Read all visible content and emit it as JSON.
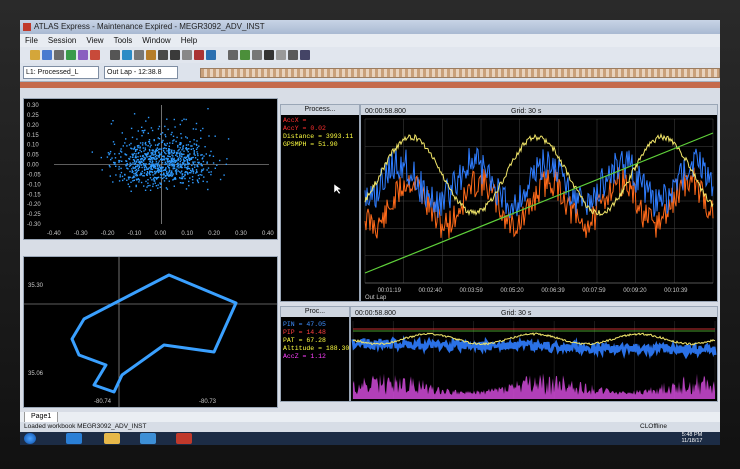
{
  "window": {
    "title": "ATLAS Express - Maintenance Expired - MEGR3092_ADV_INST"
  },
  "menu": [
    "File",
    "Session",
    "View",
    "Tools",
    "Window",
    "Help"
  ],
  "toolbar": {
    "session_combo": "L1: Processed_L",
    "lap_combo": "Out Lap - 12:38.8"
  },
  "scatter_panel": {
    "y_ticks": [
      "0.30",
      "0.25",
      "0.20",
      "0.15",
      "0.10",
      "0.05",
      "0.00",
      "-0.05",
      "-0.10",
      "-0.15",
      "-0.20",
      "-0.25",
      "-0.30"
    ],
    "x_ticks": [
      "-0.40",
      "-0.30",
      "-0.20",
      "-0.10",
      "0.00",
      "0.10",
      "0.20",
      "0.30",
      "0.40"
    ]
  },
  "track_panel": {
    "y_ticks": [
      "35.06",
      "35.30"
    ],
    "x_ticks": [
      "-80.74",
      "-80.73"
    ]
  },
  "process_panel_top": {
    "title": "Process...",
    "rows": [
      {
        "name": "AccX",
        "value": "",
        "color": "#ff3030"
      },
      {
        "name": "AccY",
        "value": "0.02",
        "color": "#ff3030"
      },
      {
        "name": "Distance",
        "value": "3993.11",
        "color": "#ffff40"
      },
      {
        "name": "GPSMPH",
        "value": "51.90",
        "color": "#ffff40"
      }
    ]
  },
  "process_panel_bottom": {
    "title": "Proc...",
    "rows": [
      {
        "name": "PIN",
        "value": "47.05",
        "color": "#4090ff"
      },
      {
        "name": "PIP",
        "value": "14.48",
        "color": "#ff4040"
      },
      {
        "name": "PAT",
        "value": "67.28",
        "color": "#ffff40"
      },
      {
        "name": "Altitude",
        "value": "188.30",
        "color": "#ffff40"
      },
      {
        "name": "AccZ",
        "value": "1.12",
        "color": "#ff40ff"
      }
    ]
  },
  "trace_top": {
    "time": "00:00:58.800",
    "grid": "Grid: 30 s",
    "x_ticks": [
      "00:01:19",
      "00:02:40",
      "00:03:59",
      "00:05:20",
      "00:06:39",
      "00:07:59",
      "00:09:20",
      "00:10:39"
    ],
    "footer": "Out Lap"
  },
  "trace_bottom": {
    "time": "00:00:58.800",
    "grid": "Grid: 30 s"
  },
  "page_tab": "Page1",
  "status": {
    "message": "Loaded workbook MEGR3092_ADV_INST",
    "mode": "CLOffline",
    "clock_time": "5:48 PM",
    "clock_date": "11/18/17"
  },
  "colors": {
    "blue_trace": "#2f7dff",
    "orange_trace": "#ff6a1a",
    "yellow_trace": "#f4e86a",
    "green_trace": "#5fd03a",
    "magenta_trace": "#d04ad8"
  }
}
